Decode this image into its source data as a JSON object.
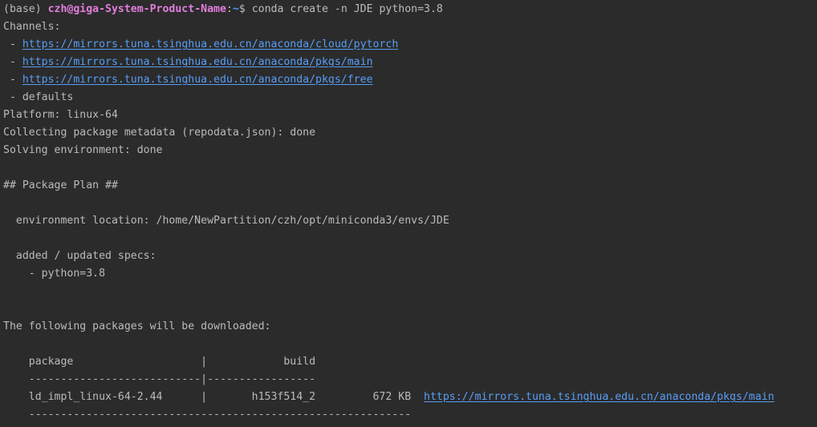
{
  "prompt": {
    "env": "(base) ",
    "user_host": "czh@giga-System-Product-Name",
    "separator": ":",
    "path": "~",
    "symbol": "$ ",
    "command": "conda create -n JDE python=3.8"
  },
  "output": {
    "channels_header": "Channels:",
    "channel_prefix": " - ",
    "channels": [
      "https://mirrors.tuna.tsinghua.edu.cn/anaconda/cloud/pytorch",
      "https://mirrors.tuna.tsinghua.edu.cn/anaconda/pkgs/main",
      "https://mirrors.tuna.tsinghua.edu.cn/anaconda/pkgs/free"
    ],
    "channel_defaults": " - defaults",
    "platform": "Platform: linux-64",
    "collecting": "Collecting package metadata (repodata.json): done",
    "solving": "Solving environment: done",
    "package_plan": "## Package Plan ##",
    "env_location": "  environment location: /home/NewPartition/czh/opt/miniconda3/envs/JDE",
    "specs_header": "  added / updated specs:",
    "spec_item": "    - python=3.8",
    "download_header": "The following packages will be downloaded:",
    "table_header": "    package                    |            build",
    "table_sep": "    ---------------------------|-----------------",
    "row_text": "    ld_impl_linux-64-2.44      |       h153f514_2         672 KB  ",
    "row_link": "https://mirrors.tuna.tsinghua.edu.cn/anaconda/pkgs/main",
    "table_bottom": "    ------------------------------------------------------------"
  }
}
